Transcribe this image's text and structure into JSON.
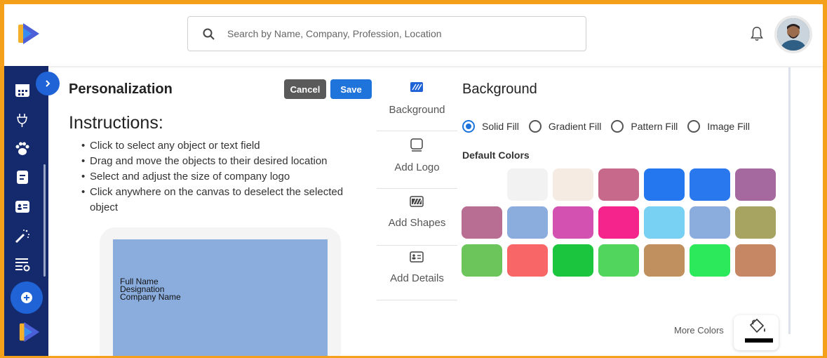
{
  "header": {
    "search_placeholder": "Search by Name, Company, Profession, Location",
    "icons": [
      "app-logo-icon",
      "search-icon",
      "bell-icon",
      "avatar"
    ]
  },
  "sidebar": {
    "icons": [
      "calendar-icon",
      "plug-icon",
      "paw-icon",
      "document-icon",
      "contact-card-icon",
      "magic-wand-icon",
      "list-settings-icon",
      "plus-circle-icon",
      "app-logo-icon"
    ]
  },
  "personalization": {
    "title": "Personalization",
    "cancel_label": "Cancel",
    "save_label": "Save",
    "instructions_heading": "Instructions:",
    "instructions": [
      "Click to select any object or text field",
      "Drag and move the objects to their desired location",
      "Select and adjust the size of company logo",
      "Click anywhere on the canvas to deselect the selected object"
    ],
    "card": {
      "full_name": "Full Name",
      "designation": "Designation",
      "company_name": "Company Name",
      "color": "#8aadde"
    }
  },
  "tools": [
    {
      "label": "Background",
      "icon": "background-icon"
    },
    {
      "label": "Add Logo",
      "icon": "logo-square-icon"
    },
    {
      "label": "Add Shapes",
      "icon": "shapes-icon"
    },
    {
      "label": "Add Details",
      "icon": "details-card-icon"
    }
  ],
  "background_panel": {
    "title": "Background",
    "fill_options": [
      {
        "label": "Solid Fill",
        "selected": true
      },
      {
        "label": "Gradient Fill",
        "selected": false
      },
      {
        "label": "Pattern Fill",
        "selected": false
      },
      {
        "label": "Image Fill",
        "selected": false
      }
    ],
    "default_colors_title": "Default Colors",
    "colors": [
      "#ffffff",
      "#f2f2f2",
      "#f5ebe2",
      "#c7698b",
      "#2477ef",
      "#2a78ee",
      "#a6699f",
      "#b86d93",
      "#8aadde",
      "#d352b1",
      "#f5248d",
      "#78d1f2",
      "#8aadde",
      "#a6a460",
      "#6cc55a",
      "#f96667",
      "#1cc53e",
      "#52d55c",
      "#c0905e",
      "#2ce95b",
      "#c58764"
    ],
    "more_colors_label": "More Colors"
  },
  "accent_colors": {
    "frame": "#f5a01a",
    "sidebar": "#152a6d",
    "primary": "#1f74db",
    "cancel": "#5a5a5a"
  }
}
